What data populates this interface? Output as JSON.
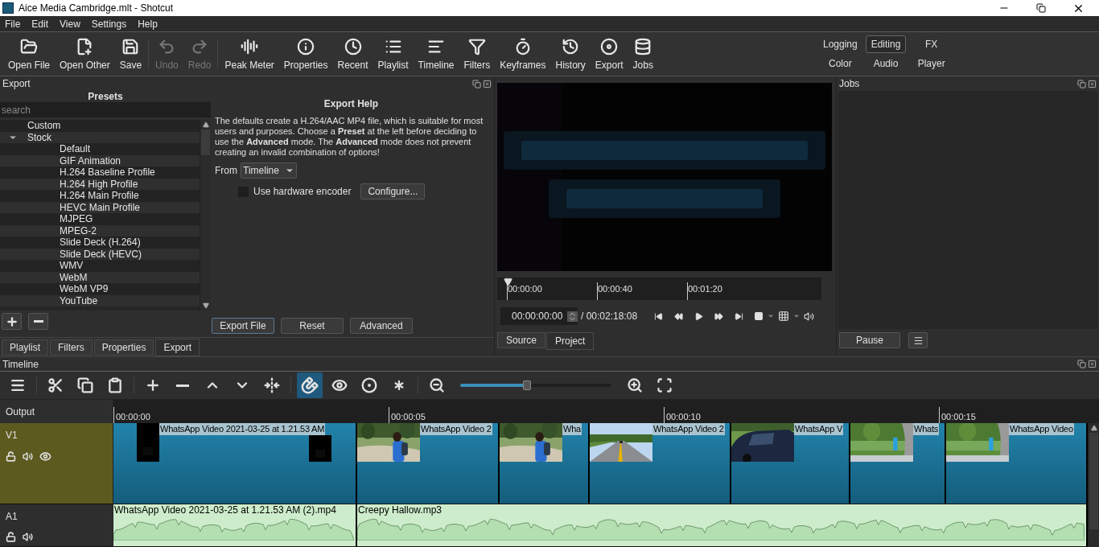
{
  "window": {
    "title": "Aice Media Cambridge.mlt - Shotcut"
  },
  "menu": [
    "File",
    "Edit",
    "View",
    "Settings",
    "Help"
  ],
  "toolbar": [
    {
      "label": "Open File",
      "disabled": false
    },
    {
      "label": "Open Other",
      "disabled": false
    },
    {
      "label": "Save",
      "disabled": false
    },
    {
      "label": "Undo",
      "disabled": true
    },
    {
      "label": "Redo",
      "disabled": true
    },
    {
      "label": "Peak Meter",
      "disabled": false
    },
    {
      "label": "Properties",
      "disabled": false
    },
    {
      "label": "Recent",
      "disabled": false
    },
    {
      "label": "Playlist",
      "disabled": false
    },
    {
      "label": "Timeline",
      "disabled": false
    },
    {
      "label": "Filters",
      "disabled": false
    },
    {
      "label": "Keyframes",
      "disabled": false
    },
    {
      "label": "History",
      "disabled": false
    },
    {
      "label": "Export",
      "disabled": false
    },
    {
      "label": "Jobs",
      "disabled": false
    }
  ],
  "layouts": [
    {
      "label": "Logging",
      "selected": false
    },
    {
      "label": "Editing",
      "selected": true
    },
    {
      "label": "FX",
      "selected": false
    },
    {
      "label": "Color",
      "selected": false
    },
    {
      "label": "Audio",
      "selected": false
    },
    {
      "label": "Player",
      "selected": false
    }
  ],
  "export": {
    "title": "Export",
    "presets_title": "Presets",
    "search": {
      "placeholder": "search"
    },
    "presets": [
      {
        "label": "Custom"
      },
      {
        "label": "Stock",
        "expanded": true,
        "children": [
          {
            "label": "Default"
          },
          {
            "label": "GIF Animation"
          },
          {
            "label": "H.264 Baseline Profile"
          },
          {
            "label": "H.264 High Profile"
          },
          {
            "label": "H.264 Main Profile"
          },
          {
            "label": "HEVC Main Profile"
          },
          {
            "label": "MJPEG"
          },
          {
            "label": "MPEG-2"
          },
          {
            "label": "Slide Deck (H.264)"
          },
          {
            "label": "Slide Deck (HEVC)"
          },
          {
            "label": "WMV"
          },
          {
            "label": "WebM"
          },
          {
            "label": "WebM VP9"
          },
          {
            "label": "YouTube"
          }
        ]
      }
    ],
    "help_title": "Export Help",
    "help": "The defaults create a H.264/AAC MP4 file, which is suitable for most users and purposes. Choose a **Preset** at the left before deciding to use the **Advanced** mode. The **Advanced** mode does not prevent creating an invalid combination of options!",
    "from_label": "From",
    "from": "Timeline",
    "hardware_encoder": {
      "label": "Use hardware encoder",
      "checked": false
    },
    "configure": "Configure...",
    "buttons": [
      "Export File",
      "Reset",
      "Advanced"
    ]
  },
  "left_tabs": [
    {
      "label": "Playlist",
      "selected": false
    },
    {
      "label": "Filters",
      "selected": false
    },
    {
      "label": "Properties",
      "selected": false
    },
    {
      "label": "Export",
      "selected": true
    }
  ],
  "player": {
    "ruler": [
      "00:00:00",
      "00:00:40",
      "00:01:20"
    ],
    "timecode": "00:00:00:00",
    "duration": "/ 00:02:18:08",
    "tabs": [
      {
        "label": "Source",
        "selected": false
      },
      {
        "label": "Project",
        "selected": true
      }
    ]
  },
  "jobs": {
    "title": "Jobs",
    "pause": "Pause"
  },
  "timeline": {
    "title": "Timeline",
    "snap": true,
    "zoom": {
      "level": 0.44
    },
    "output_label": "Output",
    "ruler": [
      "00:00:00",
      "00:00:05",
      "00:00:10",
      "00:00:15"
    ],
    "tracks": [
      {
        "name": "V1",
        "kind": "video",
        "selected": true,
        "clips": [
          {
            "label": "WhatsApp Video 2021-03-25 at 1.21.53 AM"
          },
          {
            "label": "WhatsApp Video 2"
          },
          {
            "label": "Wha"
          },
          {
            "label": "WhatsApp Video 2"
          },
          {
            "label": "WhatsApp V"
          },
          {
            "label": "Whats"
          },
          {
            "label": "WhatsApp Video"
          }
        ]
      },
      {
        "name": "A1",
        "kind": "audio",
        "selected": false,
        "clips": [
          {
            "label": "WhatsApp Video 2021-03-25 at 1.21.53 AM (2).mp4"
          },
          {
            "label": "Creepy Hallow.mp3"
          }
        ]
      }
    ]
  }
}
